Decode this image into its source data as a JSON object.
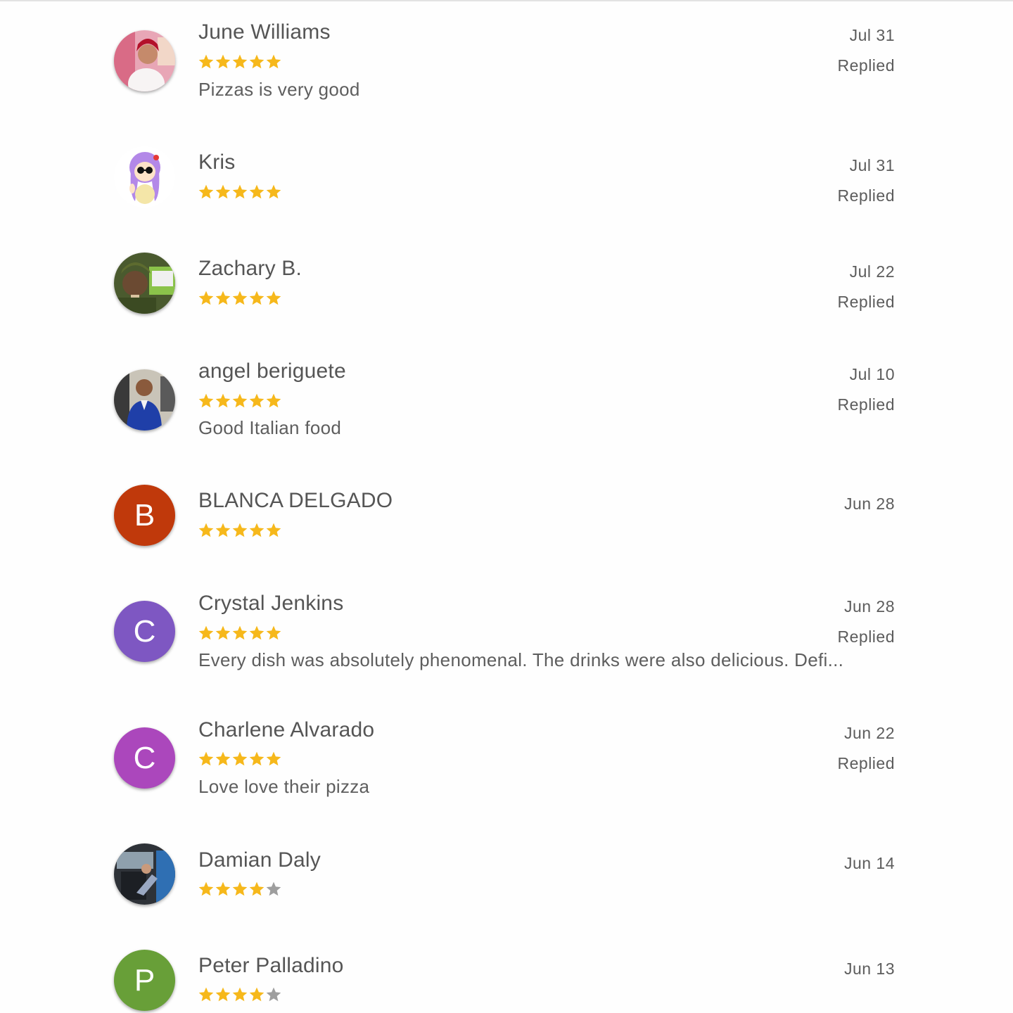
{
  "reviews": [
    {
      "name": "June Williams",
      "rating": 5,
      "text": "Pizzas is very good",
      "date": "Jul 31",
      "status": "Replied",
      "avatar": {
        "type": "photo",
        "icon": "profile-photo-icon"
      }
    },
    {
      "name": "Kris",
      "rating": 5,
      "text": "",
      "date": "Jul 31",
      "status": "Replied",
      "avatar": {
        "type": "photo",
        "icon": "cartoon-avatar-icon"
      }
    },
    {
      "name": "Zachary B.",
      "rating": 5,
      "text": "",
      "date": "Jul 22",
      "status": "Replied",
      "avatar": {
        "type": "photo",
        "icon": "profile-photo-icon"
      }
    },
    {
      "name": "angel beriguete",
      "rating": 5,
      "text": "Good Italian food",
      "date": "Jul 10",
      "status": "Replied",
      "avatar": {
        "type": "photo",
        "icon": "profile-photo-icon"
      }
    },
    {
      "name": "BLANCA DELGADO",
      "rating": 5,
      "text": "",
      "date": "Jun 28",
      "status": "",
      "avatar": {
        "type": "letter",
        "letter": "B",
        "color": "#c0390b"
      }
    },
    {
      "name": "Crystal Jenkins",
      "rating": 5,
      "text": "Every dish was absolutely phenomenal. The drinks were also delicious. Defi...",
      "date": "Jun 28",
      "status": "Replied",
      "avatar": {
        "type": "letter",
        "letter": "C",
        "color": "#7e57c2"
      }
    },
    {
      "name": "Charlene Alvarado",
      "rating": 5,
      "text": "Love love their pizza",
      "date": "Jun 22",
      "status": "Replied",
      "avatar": {
        "type": "letter",
        "letter": "C",
        "color": "#ab47bc"
      }
    },
    {
      "name": "Damian Daly",
      "rating": 4,
      "text": "",
      "date": "Jun 14",
      "status": "",
      "avatar": {
        "type": "photo",
        "icon": "profile-photo-icon"
      }
    },
    {
      "name": "Peter Palladino",
      "rating": 4,
      "text": "",
      "date": "Jun 13",
      "status": "",
      "avatar": {
        "type": "letter",
        "letter": "P",
        "color": "#689f38"
      }
    }
  ],
  "colors": {
    "star_filled": "#f6b81b",
    "star_empty": "#9e9e9e"
  }
}
